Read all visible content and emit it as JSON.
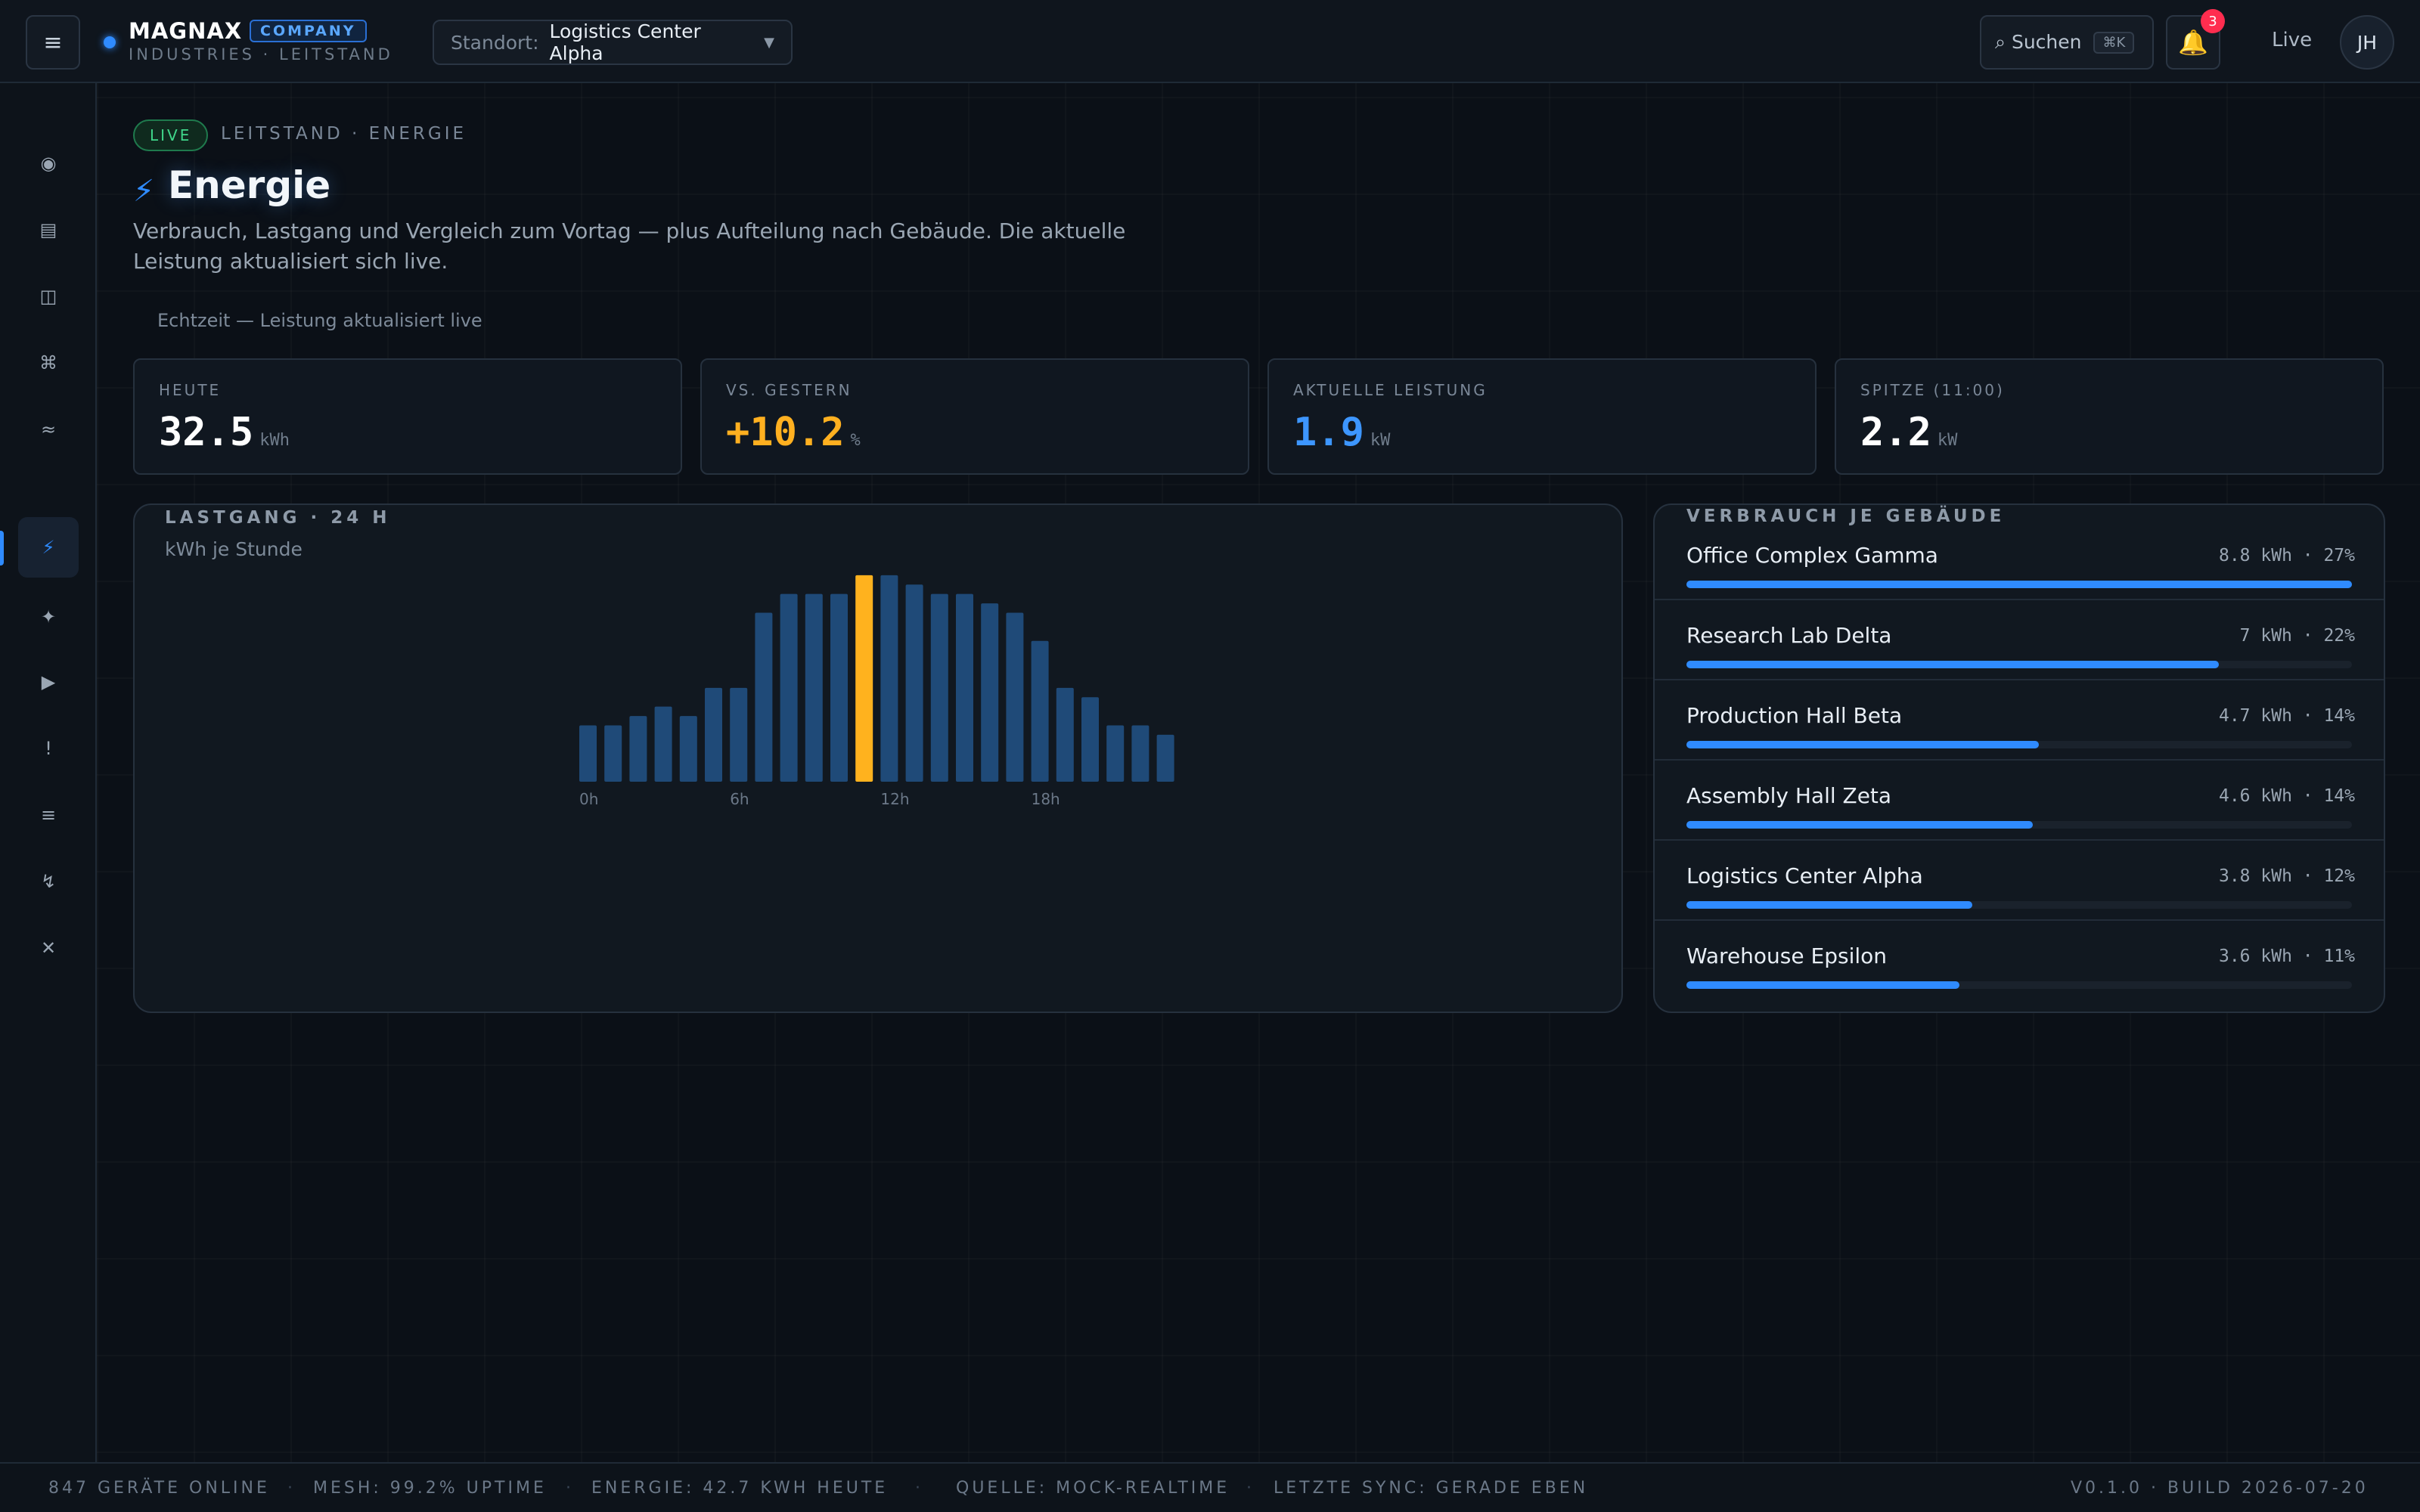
{
  "header": {
    "menu_icon": "≡",
    "brand_name": "MAGNAX",
    "brand_badge": "COMPANY",
    "brand_sub": "INDUSTRIES · LEITSTAND",
    "site_label": "Standort:",
    "site_value": "Logistics Center Alpha",
    "search_label": "⌕ Suchen",
    "search_shortcut": "⌘K",
    "notifications_count": "3",
    "live_label": "Live",
    "avatar_initials": "JH"
  },
  "sidebar": {
    "items": [
      {
        "name": "overview",
        "icon": "◉"
      },
      {
        "name": "devices",
        "icon": "▤"
      },
      {
        "name": "rooms",
        "icon": "◫"
      },
      {
        "name": "network",
        "icon": "⌘"
      },
      {
        "name": "climate",
        "icon": "≈"
      },
      {
        "name": "energy",
        "icon": "⚡",
        "active": true
      },
      {
        "name": "lighting",
        "icon": "✦"
      },
      {
        "name": "automation",
        "icon": "▶"
      },
      {
        "name": "alerts",
        "icon": "!"
      },
      {
        "name": "logs",
        "icon": "≡"
      },
      {
        "name": "power",
        "icon": "↯"
      },
      {
        "name": "settings",
        "icon": "✕"
      }
    ]
  },
  "page": {
    "live_pill": "LIVE",
    "breadcrumb": "LEITSTAND · ENERGIE",
    "title_icon": "⚡",
    "title": "Energie",
    "description": "Verbrauch, Lastgang und Vergleich zum Vortag — plus Aufteilung nach Gebäude. Die aktuelle Leistung aktualisiert sich live.",
    "realtime_note": "Echtzeit — Leistung aktualisiert live"
  },
  "kpis": [
    {
      "label": "HEUTE",
      "value": "32.5",
      "unit": "kWh",
      "color": "#ffffff"
    },
    {
      "label": "VS. GESTERN",
      "value": "+10.2",
      "unit": "%",
      "color": "#ffb020"
    },
    {
      "label": "AKTUELLE LEISTUNG",
      "value": "1.9",
      "unit": "kW",
      "color": "#3d96ff"
    },
    {
      "label": "SPITZE (11:00)",
      "value": "2.2",
      "unit": "kW",
      "color": "#ffffff"
    }
  ],
  "load_chart": {
    "title": "LASTGANG · 24 H",
    "subtitle": "kWh je Stunde"
  },
  "chart_data": {
    "type": "bar",
    "title": "LASTGANG · 24 H",
    "ylabel": "kWh je Stunde",
    "categories": [
      "0",
      "1",
      "2",
      "3",
      "4",
      "5",
      "6",
      "7",
      "8",
      "9",
      "10",
      "11",
      "12",
      "13",
      "14",
      "15",
      "16",
      "17",
      "18",
      "19",
      "20",
      "21",
      "22",
      "23"
    ],
    "values": [
      0.6,
      0.6,
      0.7,
      0.8,
      0.7,
      1.0,
      1.0,
      1.8,
      2.0,
      2.0,
      2.0,
      2.2,
      2.2,
      2.1,
      2.0,
      2.0,
      1.9,
      1.8,
      1.5,
      1.0,
      0.9,
      0.6,
      0.6,
      0.5
    ],
    "tick_labels": [
      "0h",
      "6h",
      "12h",
      "18h"
    ],
    "highlight_index": 11,
    "colors": {
      "bar": "#1f4a78",
      "highlight": "#ffb21e"
    },
    "ylim": [
      0,
      2.4
    ],
    "grid": false
  },
  "buildings": {
    "title": "VERBRAUCH JE GEBÄUDE",
    "items": [
      {
        "name": "Office Complex Gamma",
        "value": "8.8 kWh · 27%",
        "fraction": 1.0
      },
      {
        "name": "Research Lab Delta",
        "value": "7 kWh · 22%",
        "fraction": 0.8
      },
      {
        "name": "Production Hall Beta",
        "value": "4.7 kWh · 14%",
        "fraction": 0.53
      },
      {
        "name": "Assembly Hall Zeta",
        "value": "4.6 kWh · 14%",
        "fraction": 0.52
      },
      {
        "name": "Logistics Center Alpha",
        "value": "3.8 kWh · 12%",
        "fraction": 0.43
      },
      {
        "name": "Warehouse Epsilon",
        "value": "3.6 kWh · 11%",
        "fraction": 0.41
      }
    ]
  },
  "footer": {
    "devices": "847 GERÄTE ONLINE",
    "mesh": "MESH: 99.2% UPTIME",
    "energy": "ENERGIE: 42.7 KWH HEUTE",
    "source": "QUELLE: MOCK-REALTIME",
    "sync": "LETZTE SYNC: GERADE EBEN",
    "version": "V0.1.0 · BUILD 2026-07-20"
  }
}
